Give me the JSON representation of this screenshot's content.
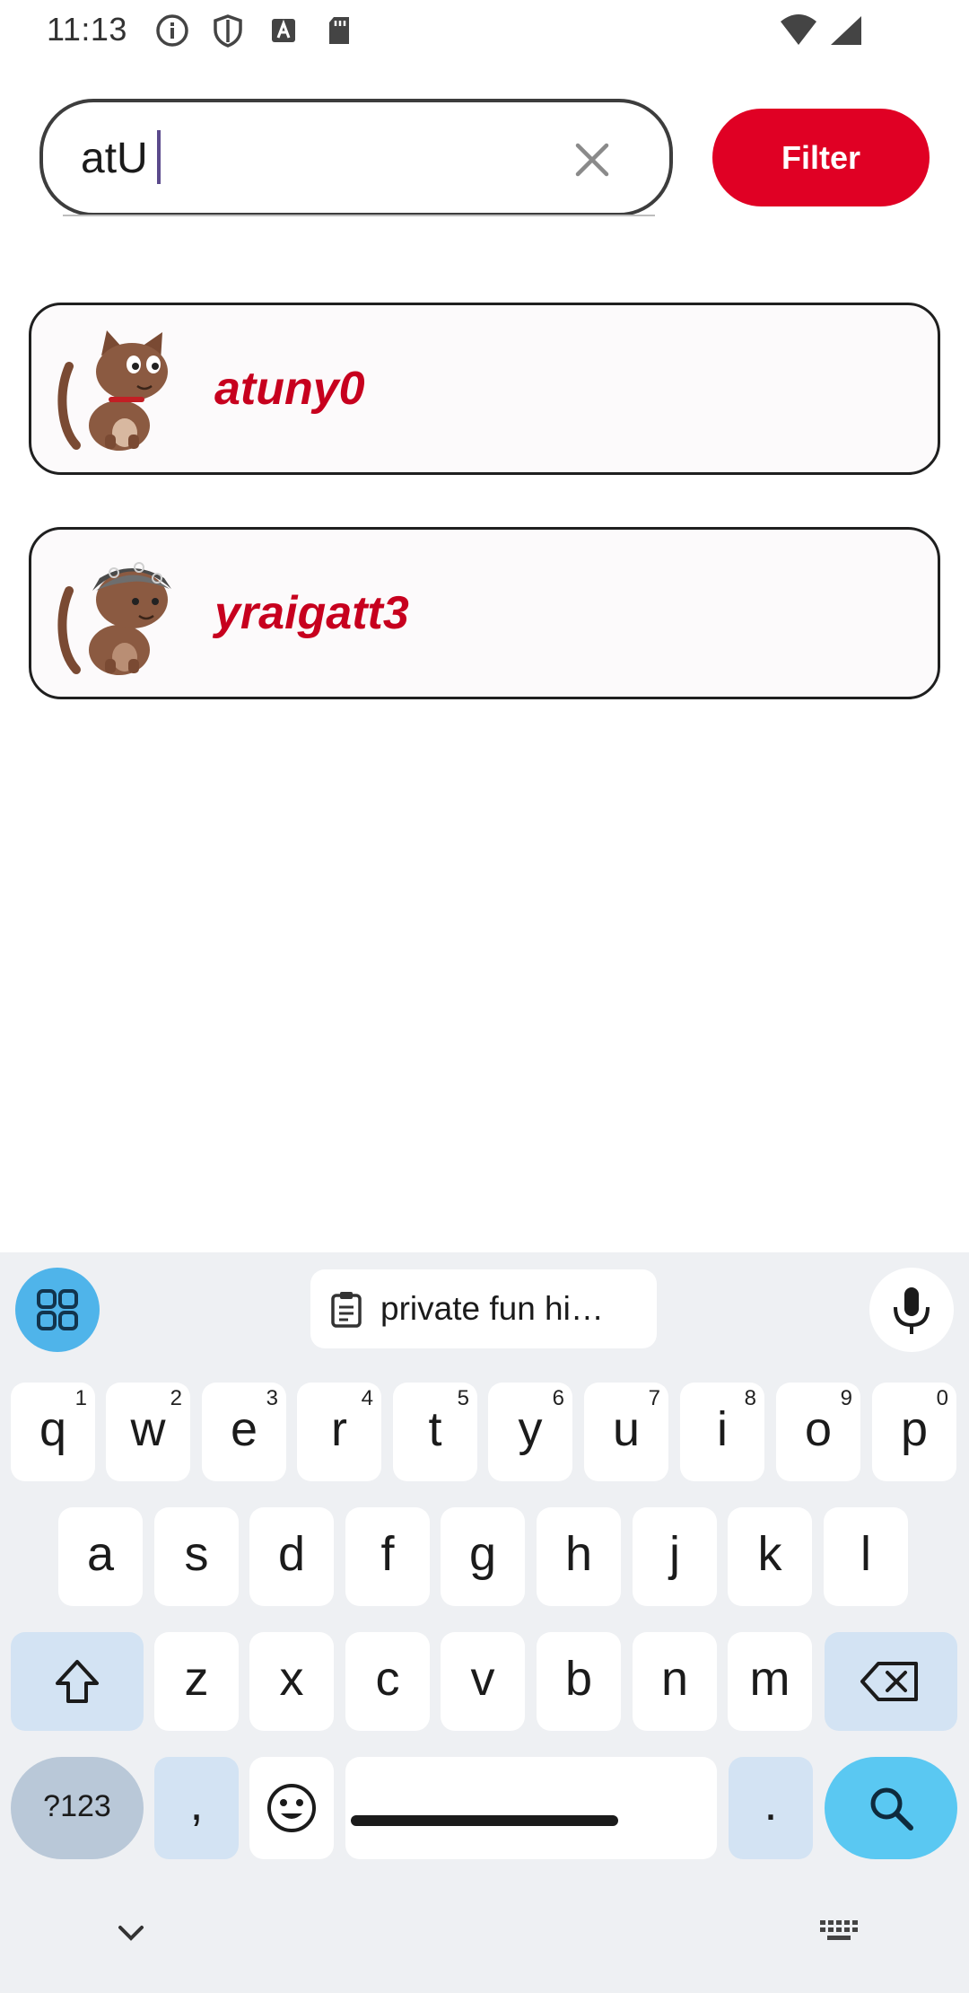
{
  "status_bar": {
    "time": "11:13",
    "icons_left": [
      "info-icon",
      "shield-icon",
      "font-icon",
      "sd-card-icon"
    ],
    "icons_right": [
      "wifi-icon",
      "signal-icon"
    ]
  },
  "search": {
    "value": "atU",
    "clear_icon": "close-icon"
  },
  "filter": {
    "label": "Filter",
    "color": "#e00024"
  },
  "results": [
    {
      "name": "atuny0",
      "avatar": "cat-avatar"
    },
    {
      "name": "yraigatt3",
      "avatar": "cat-bandana-avatar"
    }
  ],
  "keyboard": {
    "suggestion": "private fun hi…",
    "row1": [
      {
        "k": "q",
        "h": "1"
      },
      {
        "k": "w",
        "h": "2"
      },
      {
        "k": "e",
        "h": "3"
      },
      {
        "k": "r",
        "h": "4"
      },
      {
        "k": "t",
        "h": "5"
      },
      {
        "k": "y",
        "h": "6"
      },
      {
        "k": "u",
        "h": "7"
      },
      {
        "k": "i",
        "h": "8"
      },
      {
        "k": "o",
        "h": "9"
      },
      {
        "k": "p",
        "h": "0"
      }
    ],
    "row2": [
      "a",
      "s",
      "d",
      "f",
      "g",
      "h",
      "j",
      "k",
      "l"
    ],
    "row3": [
      "z",
      "x",
      "c",
      "v",
      "b",
      "n",
      "m"
    ],
    "sym_label": "?123",
    "comma": ",",
    "period": "."
  }
}
